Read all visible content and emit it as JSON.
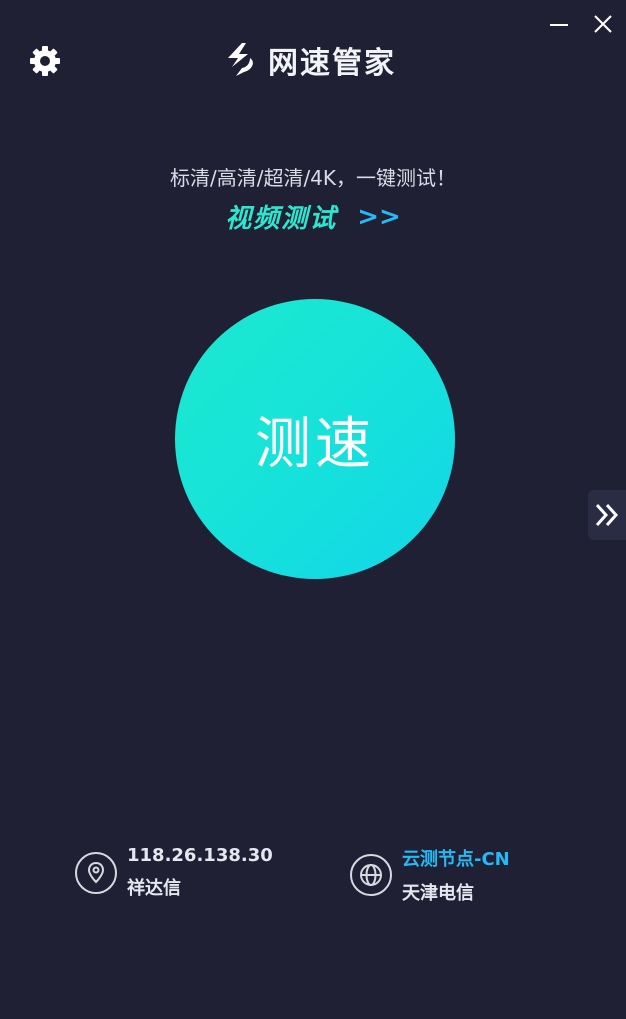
{
  "header": {
    "app_name": "网速管家",
    "icons": {
      "settings": "gear-icon",
      "logo": "brand-logo-icon",
      "minimize": "minimize-icon",
      "close": "close-icon"
    }
  },
  "promo": {
    "text": "标清/高清/超清/4K，一键测试！",
    "video_test_label": "视频测试",
    "video_test_arrow": ">>"
  },
  "speed_test": {
    "button_label": "测速"
  },
  "side_tab": {
    "icon": "double-chevron-right-icon"
  },
  "footer": {
    "ip": {
      "icon": "location-pin-icon",
      "address": "118.26.138.30",
      "isp": "祥达信"
    },
    "node": {
      "icon": "globe-icon",
      "name": "云测节点-CN",
      "carrier": "天津电信"
    }
  },
  "colors": {
    "background": "#1f2033",
    "accent_teal": "#2ee6cf",
    "accent_blue": "#27b9f5",
    "button_gradient_start": "#1de8cf",
    "button_gradient_end": "#12d6e8"
  }
}
